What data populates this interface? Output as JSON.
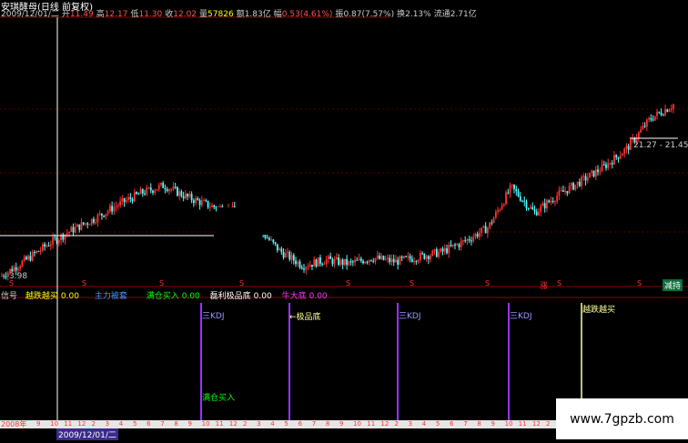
{
  "header": {
    "title": "安琪酵母(日线 前复权)",
    "date": "2009/12/01/二",
    "open_label": "开",
    "open": "11.49",
    "high_label": "高",
    "high": "12.17",
    "low_label": "低",
    "low": "11.30",
    "close_label": "收",
    "close": "12.02",
    "volume_label": "量",
    "volume": "57826",
    "amount_label": "额",
    "amount": "1.83亿",
    "change_label": "幅",
    "change": "0.53(4.61%)",
    "amplitude_label": "振",
    "amplitude": "0.87(7.57%)",
    "turnover_label": "换",
    "turnover": "2.13%",
    "float_label": "流通",
    "float": "2.71亿"
  },
  "price_labels": {
    "low_price": "3.98",
    "range": "21.27 - 21.45"
  },
  "markers": {
    "s": "S",
    "zhang": "涨",
    "jianchi": "减持"
  },
  "indicator": {
    "signal_label": "信号",
    "items": [
      {
        "name": "越跌越买",
        "value": "0.00",
        "color": "#ffff00"
      },
      {
        "name": "主力被套",
        "value": "",
        "color": "#3399ff"
      },
      {
        "name": "满仓买入",
        "value": "0.00",
        "color": "#00ff00"
      },
      {
        "name": "磊利极品底",
        "value": "0.00",
        "color": "#ffffff"
      },
      {
        "name": "牛大底",
        "value": "0.00",
        "color": "#ff33ff"
      }
    ]
  },
  "signals": {
    "kdj1": "三KDJ",
    "jipin": "←极品底",
    "kdj2": "三KDJ",
    "kdj3": "三KDJ",
    "yuedie": "越跌越买",
    "mancang": "满仓买入"
  },
  "date_bar": {
    "cursor_date": "2009/12/01/二",
    "year_label": "2008年",
    "months": [
      "9",
      "10",
      "11",
      "12",
      "2",
      "3",
      "4",
      "5",
      "6",
      "7",
      "8",
      "9",
      "10",
      "11",
      "12",
      "2",
      "3",
      "4",
      "5",
      "6",
      "7",
      "8",
      "9",
      "10",
      "11",
      "12",
      "2",
      "3",
      "4",
      "5",
      "6",
      "7",
      "8",
      "9",
      "10",
      "11",
      "12",
      "2"
    ]
  },
  "watermark": "www.7gpzb.com",
  "colors": {
    "up": "#ff3232",
    "down": "#54fcfc",
    "grid": "#8b0000",
    "signal_purple": "#9933ff",
    "signal_yellow": "#ffff99"
  },
  "chart_data": {
    "type": "line",
    "title": "安琪酵母(日线 前复权)",
    "series": [
      {
        "values": [
          3.98,
          5.5,
          7.2,
          8.6,
          9.8,
          11.2,
          12.4,
          13.2,
          12.0,
          11.1,
          10.6,
          9.0,
          6.5,
          5.0,
          5.6,
          5.2,
          5.8,
          5.4,
          5.9,
          6.4,
          7.5,
          8.9,
          13.0,
          10.4,
          12.2,
          13.6,
          15.1,
          17.0,
          20.0,
          21.45
        ]
      }
    ],
    "ylim": [
      3.98,
      21.45
    ],
    "grid": true
  }
}
